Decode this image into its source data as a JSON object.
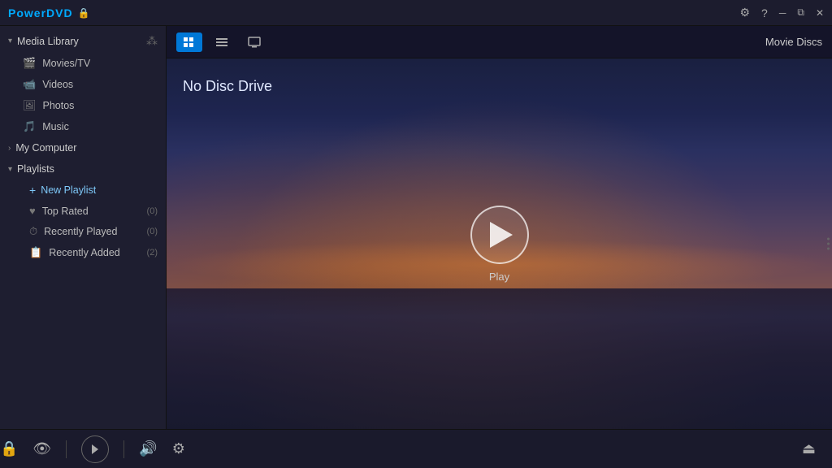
{
  "titlebar": {
    "logo": "PowerDVD",
    "lock_icon": "🔒"
  },
  "sidebar": {
    "media_library": {
      "label": "Media Library",
      "expanded": true,
      "items": [
        {
          "id": "movies-tv",
          "label": "Movies/TV",
          "icon": "🎬"
        },
        {
          "id": "videos",
          "label": "Videos",
          "icon": "📹"
        },
        {
          "id": "photos",
          "label": "Photos",
          "icon": "🖼"
        },
        {
          "id": "music",
          "label": "Music",
          "icon": "🎵"
        }
      ]
    },
    "my_computer": {
      "label": "My Computer",
      "expanded": false
    },
    "playlists": {
      "label": "Playlists",
      "expanded": true,
      "new_playlist_label": "+ New Playlist",
      "items": [
        {
          "id": "top-rated",
          "label": "Top Rated",
          "icon": "♥",
          "count": "(0)"
        },
        {
          "id": "recently-played",
          "label": "Recently Played",
          "icon": "⏱",
          "count": "(0)"
        },
        {
          "id": "recently-added",
          "label": "Recently Added",
          "icon": "📋",
          "count": "(2)"
        }
      ]
    }
  },
  "content": {
    "view_buttons": [
      {
        "id": "disc-view",
        "label": "⬤",
        "active": true
      },
      {
        "id": "grid-view",
        "label": "⊞",
        "active": false
      },
      {
        "id": "tv-view",
        "label": "📺",
        "active": false
      }
    ],
    "title": "Movie Discs",
    "no_disc_label": "No Disc Drive",
    "play_label": "Play"
  },
  "bottombar": {
    "icons": [
      {
        "id": "lock-icon",
        "symbol": "🔒"
      },
      {
        "id": "eye-icon",
        "symbol": "👁"
      },
      {
        "id": "play-icon",
        "symbol": "▶"
      },
      {
        "id": "volume-icon",
        "symbol": "🔊"
      },
      {
        "id": "settings-icon",
        "symbol": "⚙"
      },
      {
        "id": "eject-icon",
        "symbol": "⏏"
      }
    ]
  },
  "colors": {
    "active_blue": "#0078d7",
    "accent": "#00aaff",
    "bg_dark": "#1c1c2e",
    "sidebar_bg": "#1e1e30"
  }
}
